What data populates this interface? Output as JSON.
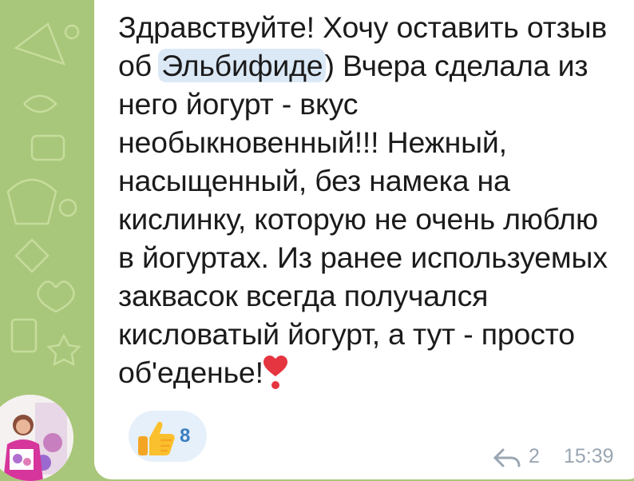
{
  "message": {
    "part1": "Здравствуйте! Хочу оставить отзыв об ",
    "highlight": "Эльбифиде",
    "part2": ") Вчера сделала из него йогурт - вкус необыкновенный!!! Нежный, насыщенный, без намека на кислинку, которую не очень люблю в йогуртах. Из ранее используемых заквасок всегда получался кисловатый йогурт, а тут - просто об'еденье!",
    "emoji": "heart-exclamation-icon"
  },
  "reaction": {
    "emoji": "thumbs-up-icon",
    "count": "8"
  },
  "meta": {
    "replies": "2",
    "time": "15:39"
  },
  "colors": {
    "chat_background": "#a9c77a",
    "bubble": "#ffffff",
    "highlight": "#dbe8f6",
    "reaction_bg": "#e6f0fa",
    "reaction_count": "#3a7fc1",
    "meta_text": "#9aa6b2"
  }
}
